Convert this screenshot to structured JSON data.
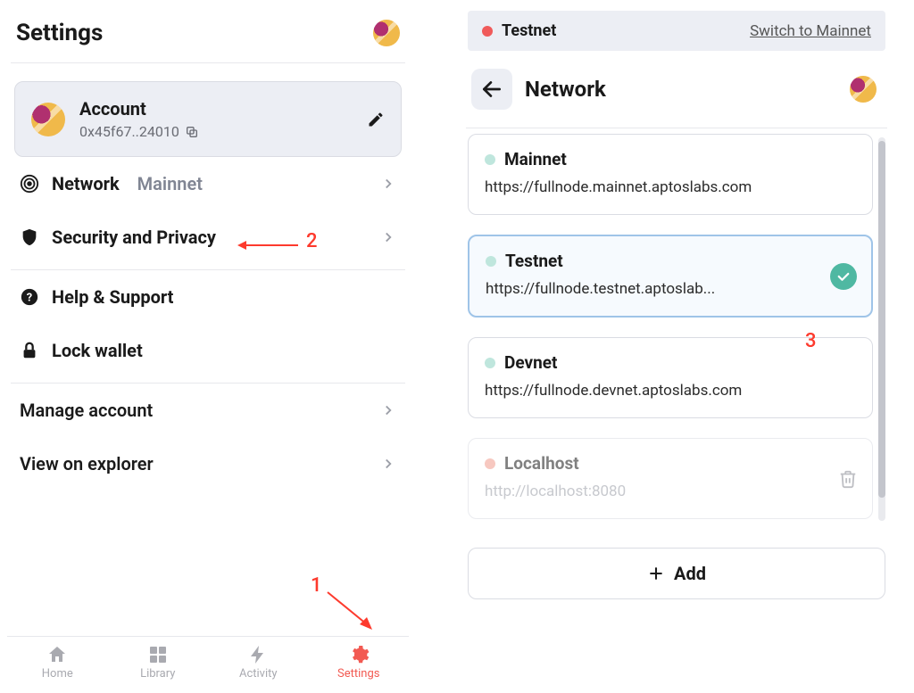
{
  "annotations": {
    "one": "1",
    "two": "2",
    "three": "3"
  },
  "left": {
    "title": "Settings",
    "account": {
      "title": "Account",
      "address": "0x45f67..24010"
    },
    "rows": {
      "network": {
        "label": "Network",
        "value": "Mainnet"
      },
      "security": {
        "label": "Security and Privacy"
      },
      "help": {
        "label": "Help & Support"
      },
      "lock": {
        "label": "Lock wallet"
      },
      "manage": {
        "label": "Manage account"
      },
      "explorer": {
        "label": "View on explorer"
      }
    },
    "nav": {
      "home": "Home",
      "library": "Library",
      "activity": "Activity",
      "settings": "Settings"
    }
  },
  "right": {
    "banner": {
      "label": "Testnet",
      "switch": "Switch to Mainnet"
    },
    "title": "Network",
    "networks": [
      {
        "name": "Mainnet",
        "url": "https://fullnode.mainnet.aptoslabs.com",
        "dot": "teal-light",
        "selected": false,
        "disabled": false,
        "trash": false
      },
      {
        "name": "Testnet",
        "url": "https://fullnode.testnet.aptoslab...",
        "dot": "teal-light",
        "selected": true,
        "disabled": false,
        "trash": false
      },
      {
        "name": "Devnet",
        "url": "https://fullnode.devnet.aptoslabs.com",
        "dot": "teal-light",
        "selected": false,
        "disabled": false,
        "trash": false
      },
      {
        "name": "Localhost",
        "url": "http://localhost:8080",
        "dot": "salmon",
        "selected": false,
        "disabled": true,
        "trash": true
      }
    ],
    "add": "Add"
  }
}
